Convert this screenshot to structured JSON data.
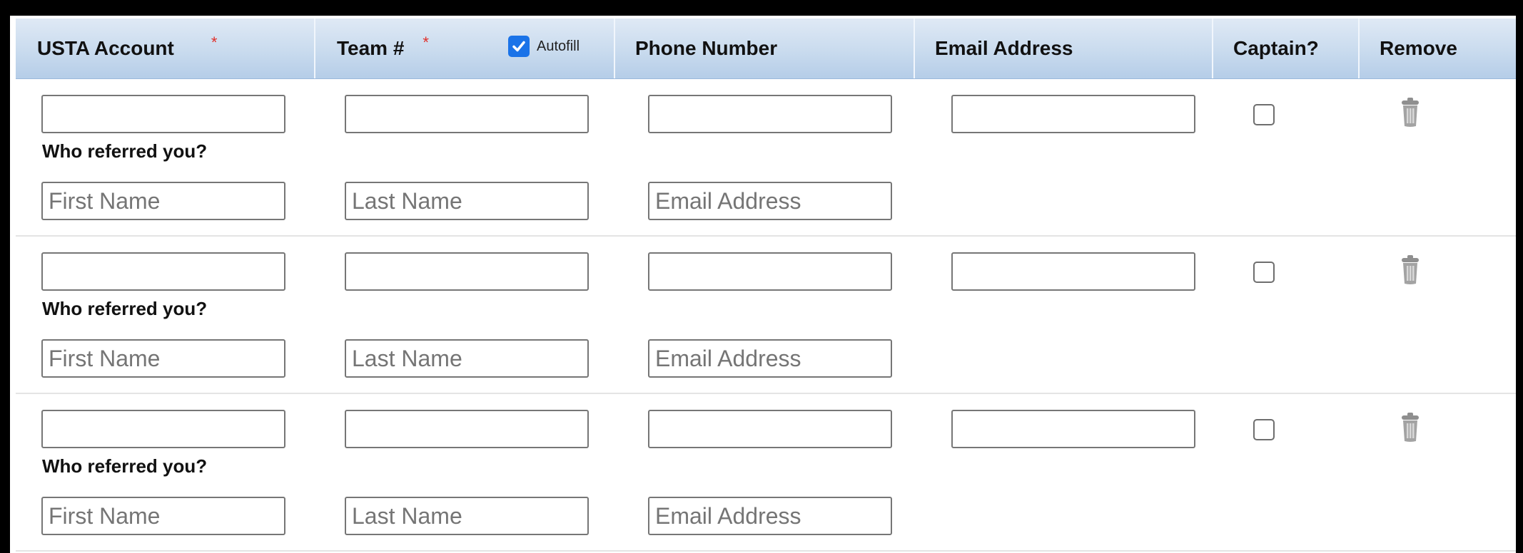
{
  "header": {
    "usta_account": "USTA Account",
    "required_mark": "*",
    "team_number": "Team #",
    "autofill_label": "Autofill",
    "phone_number": "Phone Number",
    "email_address": "Email Address",
    "captain": "Captain?",
    "remove": "Remove"
  },
  "autofill_checked": true,
  "rows": [
    {
      "usta_account": "",
      "team_number": "",
      "phone_number": "",
      "email_address": "",
      "captain_checked": false,
      "referral_label": "Who referred you?",
      "referral_first_placeholder": "First Name",
      "referral_last_placeholder": "Last Name",
      "referral_email_placeholder": "Email Address"
    },
    {
      "usta_account": "",
      "team_number": "",
      "phone_number": "",
      "email_address": "",
      "captain_checked": false,
      "referral_label": "Who referred you?",
      "referral_first_placeholder": "First Name",
      "referral_last_placeholder": "Last Name",
      "referral_email_placeholder": "Email Address"
    },
    {
      "usta_account": "",
      "team_number": "",
      "phone_number": "",
      "email_address": "",
      "captain_checked": false,
      "referral_label": "Who referred you?",
      "referral_first_placeholder": "First Name",
      "referral_last_placeholder": "Last Name",
      "referral_email_placeholder": "Email Address"
    }
  ],
  "colors": {
    "header_gradient_top": "#dfe9f5",
    "header_gradient_bottom": "#b5cde8",
    "required": "#e0302a",
    "checkbox_checked": "#1a73e8",
    "trash_icon": "#9a9a9a"
  }
}
